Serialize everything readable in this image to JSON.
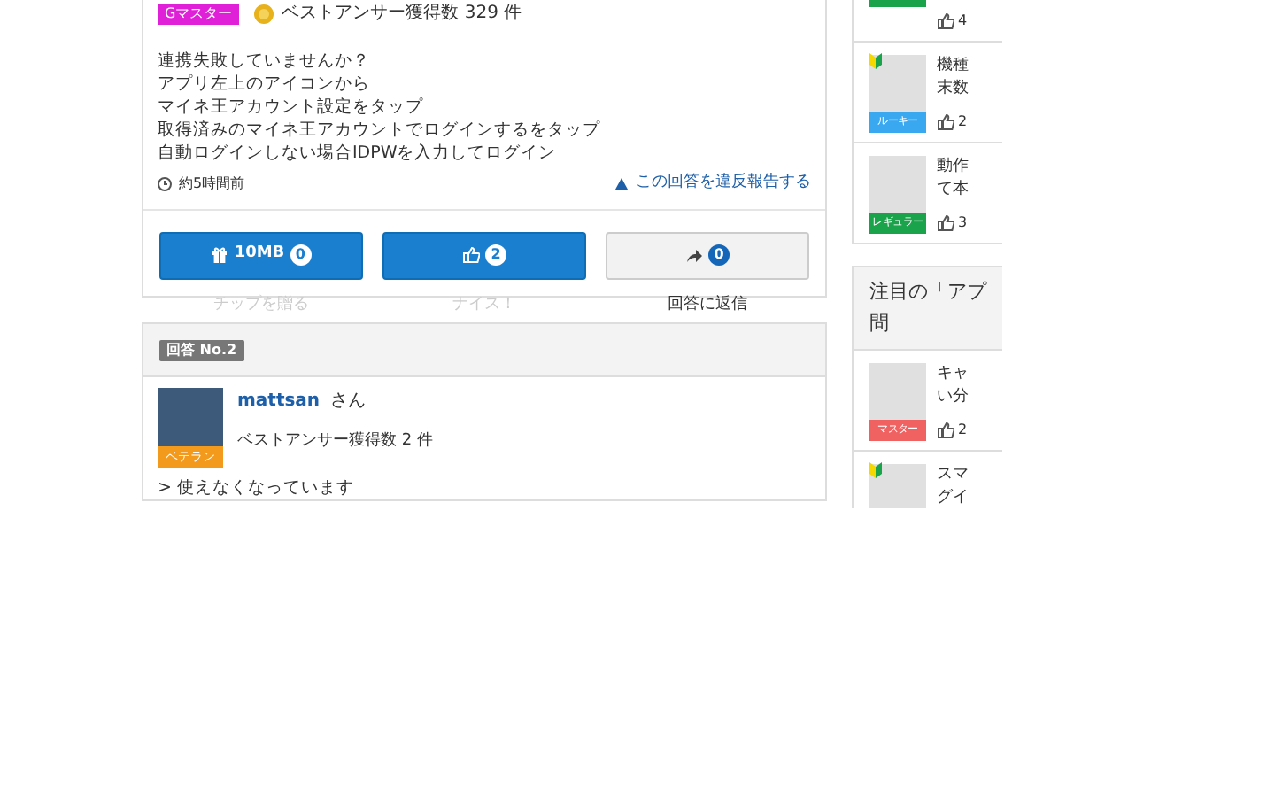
{
  "answer_1": {
    "badge": {
      "label": "Gマスター",
      "color": "#e020d8"
    },
    "best_answer_count": "ベストアンサー獲得数 329 件",
    "body": [
      "連携失敗していませんか？",
      "アプリ左上のアイコンから",
      "マイネ王アカウント設定をタップ",
      "取得済みのマイネ王アカウントでログインするをタップ",
      "自動ログインしない場合IDPWを入力してログイン"
    ],
    "time": "約5時間前",
    "report_link": "この回答を違反報告する",
    "actions": [
      {
        "kind": "tip",
        "label": "10MB",
        "count": "0",
        "caption": "チップを贈る",
        "faded": true
      },
      {
        "kind": "nice",
        "count": "2",
        "caption": "ナイス！",
        "faded": true
      },
      {
        "kind": "reply",
        "count": "0",
        "caption": "回答に返信",
        "faded": false
      }
    ]
  },
  "answer_2": {
    "header": "回答 No.2",
    "user": "mattsan",
    "honorific": "さん",
    "badge": {
      "label": "ベテラン",
      "color": "#f39a1c"
    },
    "best_answer_count": "ベストアンサー獲得数 2 件",
    "body": "> 使えなくなっています"
  },
  "sidebar": [
    {
      "items": [
        {
          "likes": "4",
          "beginner": false,
          "color": "#1aa34a"
        },
        {
          "lines": [
            "機種",
            "末数"
          ],
          "badge": "ルーキー",
          "likes": "2",
          "beginner": true,
          "color": "#3aa8f0"
        },
        {
          "lines": [
            "動作",
            "て本"
          ],
          "badge": "レギュラー",
          "likes": "3",
          "beginner": false,
          "color": "#1aa34a"
        }
      ]
    },
    {
      "title": [
        "注目の「アプ",
        "問"
      ],
      "items": [
        {
          "lines": [
            "キャ",
            "い分"
          ],
          "badge": "マスター",
          "likes": "2",
          "beginner": false,
          "color": "#f06262"
        },
        {
          "lines": [
            "スマ",
            "グイ"
          ],
          "beginner": true
        }
      ]
    }
  ]
}
